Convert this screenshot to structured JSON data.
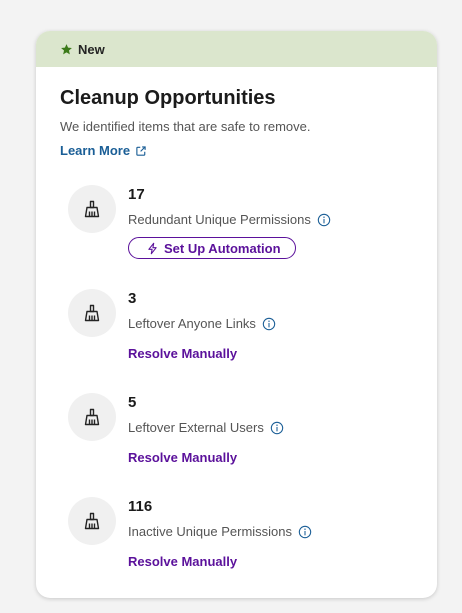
{
  "banner": {
    "label": "New",
    "icon": "star-icon",
    "color": "#dbe6cd",
    "icon_color": "#3c7a1a"
  },
  "title": "Cleanup Opportunities",
  "subtitle": "We identified items that are safe to remove.",
  "learn_more": {
    "label": "Learn More",
    "icon": "external-link-icon",
    "color": "#1a5e96"
  },
  "accent_color": "#5b119b",
  "items": [
    {
      "count": "17",
      "label": "Redundant Unique Permissions",
      "action": "Set Up Automation",
      "action_type": "button",
      "icon": "broom-icon"
    },
    {
      "count": "3",
      "label": "Leftover Anyone Links",
      "action": "Resolve Manually",
      "action_type": "link",
      "icon": "broom-icon"
    },
    {
      "count": "5",
      "label": "Leftover External Users",
      "action": "Resolve Manually",
      "action_type": "link",
      "icon": "broom-icon"
    },
    {
      "count": "116",
      "label": "Inactive Unique Permissions",
      "action": "Resolve Manually",
      "action_type": "link",
      "icon": "broom-icon"
    }
  ]
}
